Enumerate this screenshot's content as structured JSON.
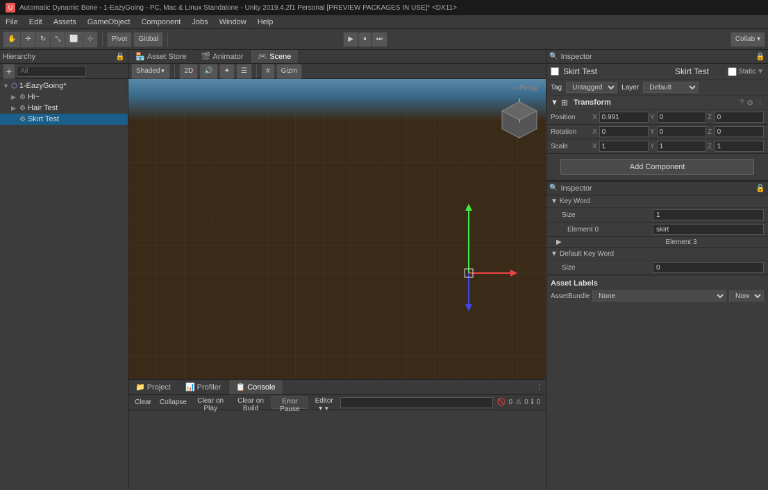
{
  "titleBar": {
    "text": "Automatic Dynamic Bone - 1-EazyGoing - PC, Mac & Linux Standalone - Unity 2019.4.2f1 Personal [PREVIEW PACKAGES IN USE]* <DX11>"
  },
  "menuBar": {
    "items": [
      "File",
      "Edit",
      "Assets",
      "GameObject",
      "Component",
      "Jobs",
      "Window",
      "Help"
    ]
  },
  "toolbar": {
    "pivot": "Pivot",
    "global": "Global",
    "collab": "Collab ▾",
    "playBtn": "▶",
    "pauseBtn": "⏸",
    "stepBtn": "⏭"
  },
  "hierarchy": {
    "title": "Hierarchy",
    "searchPlaceholder": "All",
    "items": [
      {
        "label": "1-EazyGoing*",
        "indent": 0,
        "expanded": true,
        "hasArrow": true
      },
      {
        "label": "Hi~",
        "indent": 1,
        "expanded": false,
        "hasArrow": true
      },
      {
        "label": "Hair Test",
        "indent": 1,
        "expanded": false,
        "hasArrow": true
      },
      {
        "label": "Skirt Test",
        "indent": 1,
        "expanded": false,
        "hasArrow": false,
        "selected": true
      }
    ]
  },
  "tabs": {
    "items": [
      "Asset Store",
      "Animator",
      "Scene"
    ]
  },
  "sceneToolbar": {
    "shading": "Shaded",
    "mode": "2D",
    "gizmos": "Gizm"
  },
  "viewport": {
    "perspLabel": "< Persp"
  },
  "inspector": {
    "title": "Inspector",
    "objectName": "Skirt Test",
    "staticLabel": "Static",
    "staticChecked": false,
    "tag": "Untagged",
    "layer": "Default",
    "transform": {
      "title": "Transform",
      "position": {
        "label": "Position",
        "x": "0.991",
        "y": "0",
        "z": "0"
      },
      "rotation": {
        "label": "Rotation",
        "x": "0",
        "y": "0",
        "z": "0"
      },
      "scale": {
        "label": "Scale",
        "x": "1",
        "y": "1",
        "z": "1"
      }
    },
    "addComponentLabel": "Add Component"
  },
  "console": {
    "tabs": [
      {
        "label": "Project",
        "icon": "📁"
      },
      {
        "label": "Profiler",
        "icon": "📊"
      },
      {
        "label": "Console",
        "icon": "📋"
      }
    ],
    "activeTab": "Console",
    "toolbar": {
      "clearBtn": "Clear",
      "collapseBtn": "Collapse",
      "clearOnPlay": "Clear on Play",
      "clearOnBuild": "Clear on Build",
      "errorPause": "Error Pause",
      "editor": "Editor ▾"
    },
    "searchPlaceholder": "",
    "errorCount": "0",
    "warningCount": "0",
    "infoCount": "0"
  },
  "inspectorBottom": {
    "title": "Inspector",
    "keyWord": {
      "title": "Key Word",
      "size": {
        "label": "Size",
        "value": "1"
      },
      "element0": {
        "label": "Element 0",
        "value": "skirt"
      },
      "element3": {
        "label": "Element 3"
      }
    },
    "defaultKeyWord": {
      "title": "Default Key Word",
      "size": {
        "label": "Size",
        "value": "0"
      }
    },
    "assetLabels": {
      "title": "Asset Labels",
      "assetBundle": {
        "label": "AssetBundle",
        "value": "None",
        "value2": "None"
      }
    }
  }
}
